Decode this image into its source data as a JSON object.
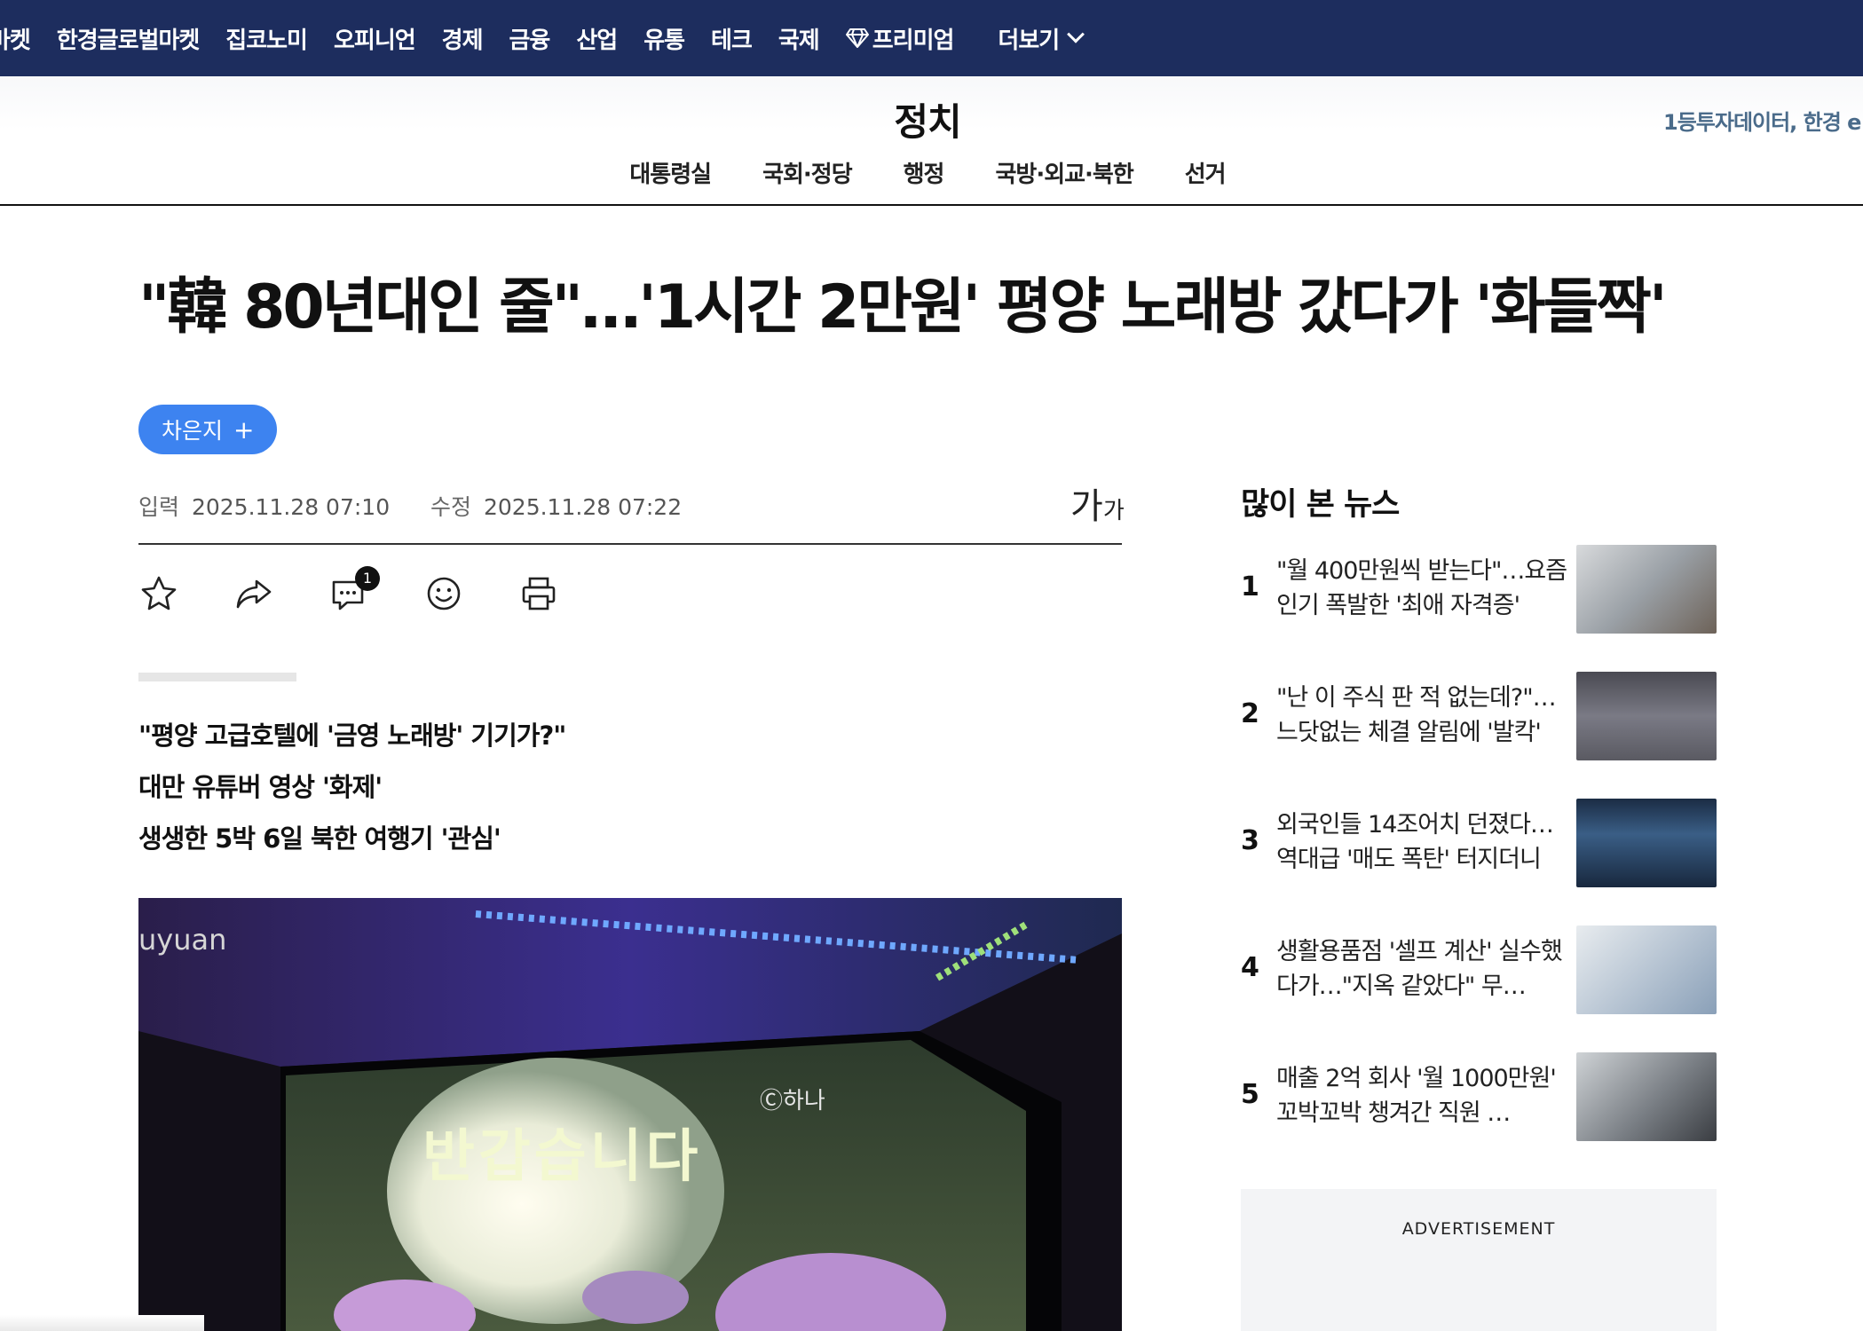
{
  "topnav": {
    "items": [
      "마켓",
      "한경글로벌마켓",
      "집코노미",
      "오피니언",
      "경제",
      "금융",
      "산업",
      "유통",
      "테크",
      "국제",
      "프리미엄"
    ],
    "more_label": "더보기"
  },
  "section": {
    "title": "정치",
    "promo": "1등투자데이터, 한경 e",
    "subnav": [
      "대통령실",
      "국회·정당",
      "행정",
      "국방·외교·북한",
      "선거"
    ]
  },
  "article": {
    "headline": "\"韓 80년대인 줄\"…'1시간 2만원' 평양 노래방 갔다가 '화들짝'",
    "author": "차은지",
    "author_plus": "+",
    "input_label": "입력",
    "input_date": "2025.11.28 07:10",
    "edit_label": "수정",
    "edit_date": "2025.11.28 07:22",
    "font_size_big": "가",
    "font_size_small": "가",
    "comment_count": "1",
    "summary": [
      "\"평양 고급호텔에 '금영 노래방' 기기가?\"",
      "대만 유튜버 영상 '화제'",
      "생생한 5박 6일 북한 여행기 '관심'"
    ],
    "image_tag": "uyuan",
    "image_caption": "반갑습니다",
    "image_logo": "Ⓒ하나"
  },
  "sidebar": {
    "title": "많이 본 뉴스",
    "items": [
      {
        "rank": "1",
        "title": "\"월 400만원씩 받는다\"…요즘 인기 폭발한 '최애 자격증'"
      },
      {
        "rank": "2",
        "title": "\"난 이 주식 판 적 없는데?\"…느닷없는 체결 알림에 '발칵'"
      },
      {
        "rank": "3",
        "title": "외국인들 14조어치 던졌다…역대급 '매도 폭탄' 터지더니"
      },
      {
        "rank": "4",
        "title": "생활용품점 '셀프 계산' 실수했다가…\"지옥 같았다\" 무…"
      },
      {
        "rank": "5",
        "title": "매출 2억 회사 '월 1000만원' 꼬박꼬박 챙겨간 직원 …"
      }
    ],
    "ad_label": "ADVERTISEMENT"
  },
  "colors": {
    "nav_bg": "#1d2d5e",
    "author_chip": "#3d83f0"
  }
}
